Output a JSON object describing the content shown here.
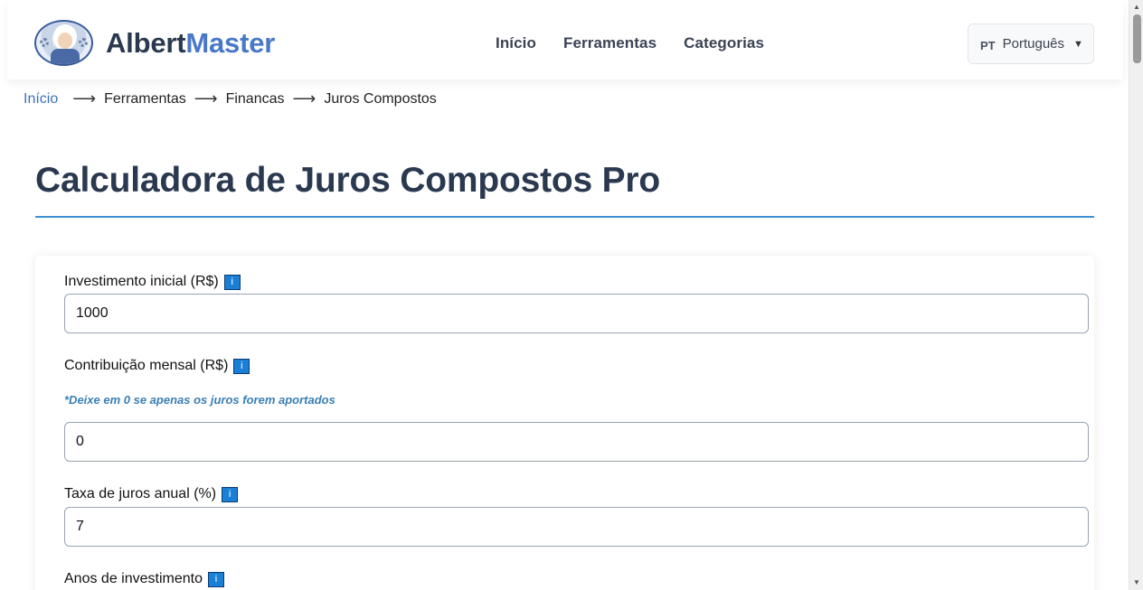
{
  "header": {
    "logo_text_a": "Albert",
    "logo_text_b": "Master",
    "nav": [
      {
        "label": "Início"
      },
      {
        "label": "Ferramentas"
      },
      {
        "label": "Categorias"
      }
    ],
    "language": {
      "code": "PT",
      "label": "Português",
      "caret": "▼"
    }
  },
  "breadcrumb": {
    "items": [
      "Início",
      "Ferramentas",
      "Financas",
      "Juros Compostos"
    ],
    "separator": "⟶"
  },
  "page": {
    "title": "Calculadora de Juros Compostos Pro"
  },
  "form": {
    "info_glyph": "i",
    "fields": [
      {
        "label": "Investimento inicial (R$)",
        "value": "1000"
      },
      {
        "label": "Contribuição mensal (R$)",
        "hint": "*Deixe em 0 se apenas os juros forem aportados",
        "value": "0"
      },
      {
        "label": "Taxa de juros anual (%)",
        "value": "7"
      },
      {
        "label": "Anos de investimento",
        "value": ""
      }
    ]
  },
  "colors": {
    "brand_dark": "#2b3950",
    "brand_blue": "#4a78c8",
    "link": "#3d6fc4",
    "accent_line": "#3d8fd6",
    "hint": "#3a7fb5",
    "info_badge": "#1c7fd6"
  }
}
